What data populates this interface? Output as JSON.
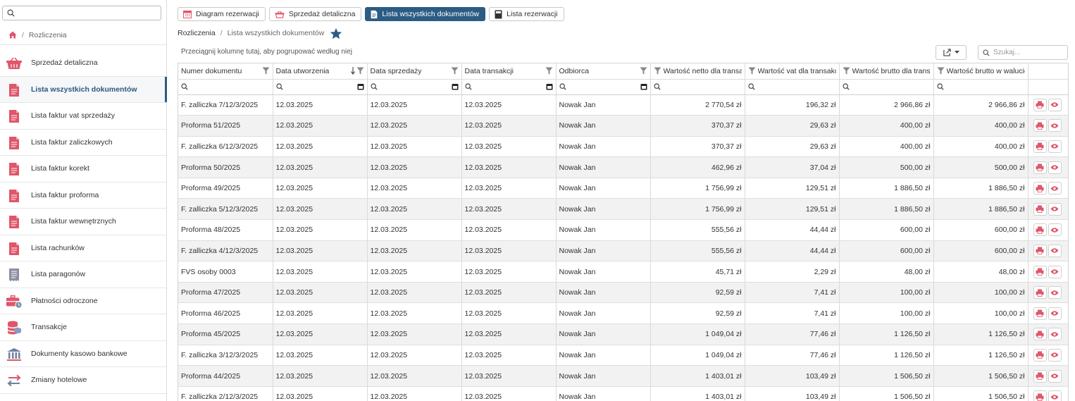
{
  "sidebar": {
    "search_value": "",
    "breadcrumb": {
      "home_icon": "home-icon",
      "current": "Rozliczenia"
    },
    "items": [
      {
        "label": "Sprzedaż detaliczna",
        "icon": "basket-icon",
        "active": false
      },
      {
        "label": "Lista wszystkich dokumentów",
        "icon": "document-icon",
        "active": true
      },
      {
        "label": "Lista faktur vat sprzedaży",
        "icon": "document-icon",
        "active": false
      },
      {
        "label": "Lista faktur zaliczkowych",
        "icon": "document-icon",
        "active": false
      },
      {
        "label": "Lista faktur korekt",
        "icon": "document-icon",
        "active": false
      },
      {
        "label": "Lista faktur proforma",
        "icon": "document-icon",
        "active": false
      },
      {
        "label": "Lista faktur wewnętrznych",
        "icon": "document-icon",
        "active": false
      },
      {
        "label": "Lista rachunków",
        "icon": "document-icon",
        "active": false
      },
      {
        "label": "Lista paragonów",
        "icon": "receipt-icon",
        "active": false
      },
      {
        "label": "Płatności odroczone",
        "icon": "briefcase-clock-icon",
        "active": false
      },
      {
        "label": "Transakcje",
        "icon": "coins-icon",
        "active": false
      },
      {
        "label": "Dokumenty kasowo bankowe",
        "icon": "bank-icon",
        "active": false
      },
      {
        "label": "Zmiany hotelowe",
        "icon": "swap-arrows-icon",
        "active": false
      }
    ]
  },
  "tabs": [
    {
      "label": "Diagram rezerwacji",
      "icon": "calendar-icon",
      "active": false
    },
    {
      "label": "Sprzedaż detaliczna",
      "icon": "basket-icon",
      "active": false
    },
    {
      "label": "Lista wszystkich dokumentów",
      "icon": "document-icon",
      "active": true
    },
    {
      "label": "Lista rezerwacji",
      "icon": "book-icon",
      "active": false
    }
  ],
  "breadcrumb": {
    "root": "Rozliczenia",
    "current": "Lista wszystkich dokumentów"
  },
  "grid": {
    "group_hint": "Przeciągnij kolumnę tutaj, aby pogrupować według niej",
    "search_placeholder": "Szukaj...",
    "columns": [
      "Numer dokumentu",
      "Data utworzenia",
      "Data sprzedaży",
      "Data transakcji",
      "Odbiorca",
      "Wartość netto dla transakcji",
      "Wartość vat dla transakcji",
      "Wartość brutto dla transakcji",
      "Wartość brutto w walucie"
    ],
    "rows": [
      [
        "F. zalliczka 7/12/3/2025",
        "12.03.2025",
        "12.03.2025",
        "12.03.2025",
        "Nowak Jan",
        "2 770,54 zł",
        "196,32 zł",
        "2 966,86 zł",
        "2 966,86 zł"
      ],
      [
        "Proforma 51/2025",
        "12.03.2025",
        "12.03.2025",
        "12.03.2025",
        "Nowak Jan",
        "370,37 zł",
        "29,63 zł",
        "400,00 zł",
        "400,00 zł"
      ],
      [
        "F. zalliczka 6/12/3/2025",
        "12.03.2025",
        "12.03.2025",
        "12.03.2025",
        "Nowak Jan",
        "370,37 zł",
        "29,63 zł",
        "400,00 zł",
        "400,00 zł"
      ],
      [
        "Proforma 50/2025",
        "12.03.2025",
        "12.03.2025",
        "12.03.2025",
        "Nowak Jan",
        "462,96 zł",
        "37,04 zł",
        "500,00 zł",
        "500,00 zł"
      ],
      [
        "Proforma 49/2025",
        "12.03.2025",
        "12.03.2025",
        "12.03.2025",
        "Nowak Jan",
        "1 756,99 zł",
        "129,51 zł",
        "1 886,50 zł",
        "1 886,50 zł"
      ],
      [
        "F. zalliczka 5/12/3/2025",
        "12.03.2025",
        "12.03.2025",
        "12.03.2025",
        "Nowak Jan",
        "1 756,99 zł",
        "129,51 zł",
        "1 886,50 zł",
        "1 886,50 zł"
      ],
      [
        "Proforma 48/2025",
        "12.03.2025",
        "12.03.2025",
        "12.03.2025",
        "Nowak Jan",
        "555,56 zł",
        "44,44 zł",
        "600,00 zł",
        "600,00 zł"
      ],
      [
        "F. zalliczka 4/12/3/2025",
        "12.03.2025",
        "12.03.2025",
        "12.03.2025",
        "Nowak Jan",
        "555,56 zł",
        "44,44 zł",
        "600,00 zł",
        "600,00 zł"
      ],
      [
        "FVS osoby 0003",
        "12.03.2025",
        "12.03.2025",
        "12.03.2025",
        "Nowak Jan",
        "45,71 zł",
        "2,29 zł",
        "48,00 zł",
        "48,00 zł"
      ],
      [
        "Proforma 47/2025",
        "12.03.2025",
        "12.03.2025",
        "12.03.2025",
        "Nowak Jan",
        "92,59 zł",
        "7,41 zł",
        "100,00 zł",
        "100,00 zł"
      ],
      [
        "Proforma 46/2025",
        "12.03.2025",
        "12.03.2025",
        "12.03.2025",
        "Nowak Jan",
        "92,59 zł",
        "7,41 zł",
        "100,00 zł",
        "100,00 zł"
      ],
      [
        "Proforma 45/2025",
        "12.03.2025",
        "12.03.2025",
        "12.03.2025",
        "Nowak Jan",
        "1 049,04 zł",
        "77,46 zł",
        "1 126,50 zł",
        "1 126,50 zł"
      ],
      [
        "F. zalliczka 3/12/3/2025",
        "12.03.2025",
        "12.03.2025",
        "12.03.2025",
        "Nowak Jan",
        "1 049,04 zł",
        "77,46 zł",
        "1 126,50 zł",
        "1 126,50 zł"
      ],
      [
        "Proforma 44/2025",
        "12.03.2025",
        "12.03.2025",
        "12.03.2025",
        "Nowak Jan",
        "1 403,01 zł",
        "103,49 zł",
        "1 506,50 zł",
        "1 506,50 zł"
      ],
      [
        "F. zalliczka 2/12/3/2025",
        "12.03.2025",
        "12.03.2025",
        "12.03.2025",
        "Nowak Jan",
        "1 403,01 zł",
        "103,49 zł",
        "1 506,50 zł",
        "1 506,50 zł"
      ]
    ],
    "row_actions": [
      "print-icon",
      "eye-icon"
    ]
  },
  "colors": {
    "accent": "#2b5c84",
    "icon_red": "#e0566a",
    "star": "#2b5c84"
  }
}
